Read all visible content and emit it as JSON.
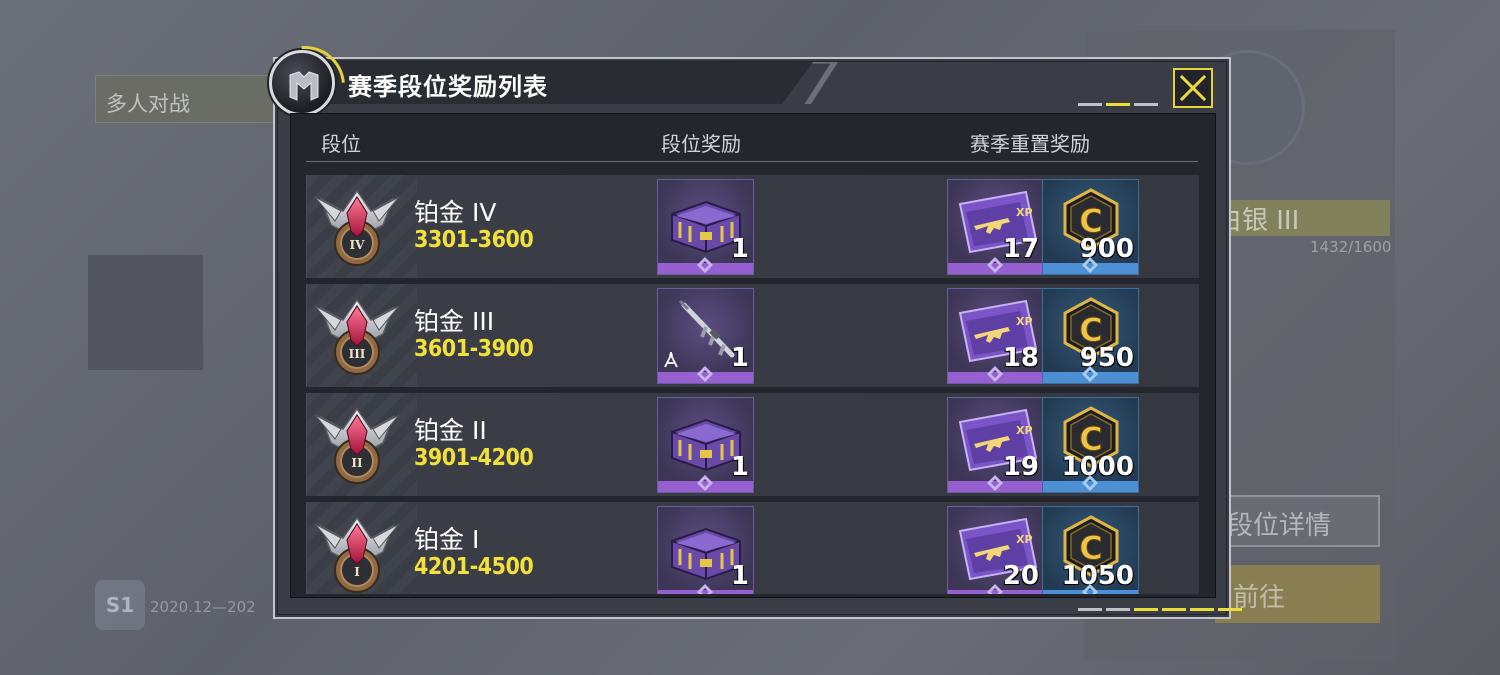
{
  "background": {
    "mode_label": "多人对战",
    "rank_text": "白银 III",
    "progress_text": "1432/1600",
    "detail_button": "段位详情",
    "goto_button": "前往",
    "season_badge": "S1",
    "date_text": "2020.12—202"
  },
  "dialog": {
    "title": "赛季段位奖励列表",
    "columns": {
      "rank": "段位",
      "rank_reward": "段位奖励",
      "season_reset_reward": "赛季重置奖励"
    },
    "pager_top": {
      "pages": 3,
      "active": 2
    },
    "pager_bottom": {
      "pages": 6,
      "active": [
        3,
        4,
        5,
        6
      ]
    },
    "rows": [
      {
        "rank_name": "铂金 IV",
        "rank_range": "3301-3600",
        "rank_numeral": "IV",
        "reward_type": "crate-icon",
        "reward_qty": "1",
        "xp_card_qty": "17",
        "cp_qty": "900"
      },
      {
        "rank_name": "铂金 III",
        "rank_range": "3601-3900",
        "rank_numeral": "III",
        "reward_type": "weapon-blueprint-icon",
        "reward_qty": "1",
        "xp_card_qty": "18",
        "cp_qty": "950"
      },
      {
        "rank_name": "铂金 II",
        "rank_range": "3901-4200",
        "rank_numeral": "II",
        "reward_type": "crate-icon",
        "reward_qty": "1",
        "xp_card_qty": "19",
        "cp_qty": "1000"
      },
      {
        "rank_name": "铂金 I",
        "rank_range": "4201-4500",
        "rank_numeral": "I",
        "reward_type": "crate-icon",
        "reward_qty": "1",
        "xp_card_qty": "20",
        "cp_qty": "1050"
      }
    ]
  },
  "colors": {
    "accent_yellow": "#f3e13a",
    "rarity_epic": "#9660d0",
    "rarity_rare": "#4d8fd4",
    "panel_dark": "#24262d",
    "row_bg": "#3b3e47"
  }
}
